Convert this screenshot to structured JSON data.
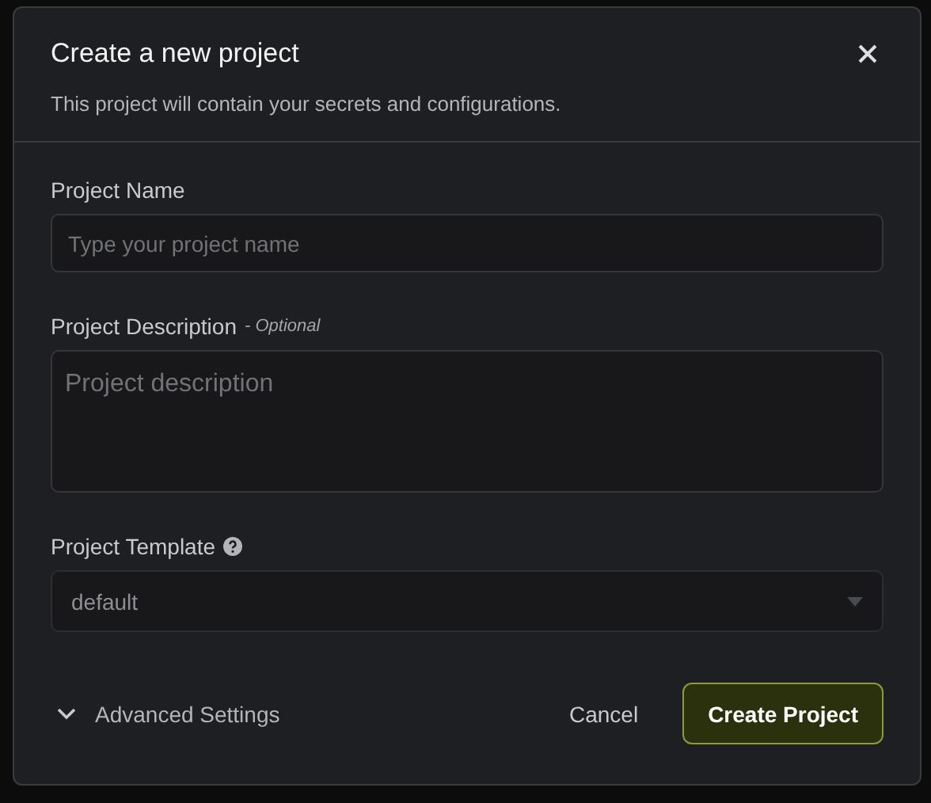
{
  "dialog": {
    "title": "Create a new project",
    "subtitle": "This project will contain your secrets and configurations."
  },
  "fields": [
    {
      "kind": "input",
      "label": "Project Name",
      "placeholder": "Type your project name"
    },
    {
      "kind": "textarea",
      "label": "Project Description",
      "note": "- Optional",
      "placeholder": "Project description"
    },
    {
      "kind": "select",
      "label": "Project Template",
      "help": true,
      "value": "default"
    }
  ],
  "advanced": {
    "label": "Advanced Settings",
    "expanded": false
  },
  "buttons": {
    "cancel": "Cancel",
    "submit": "Create Project"
  }
}
